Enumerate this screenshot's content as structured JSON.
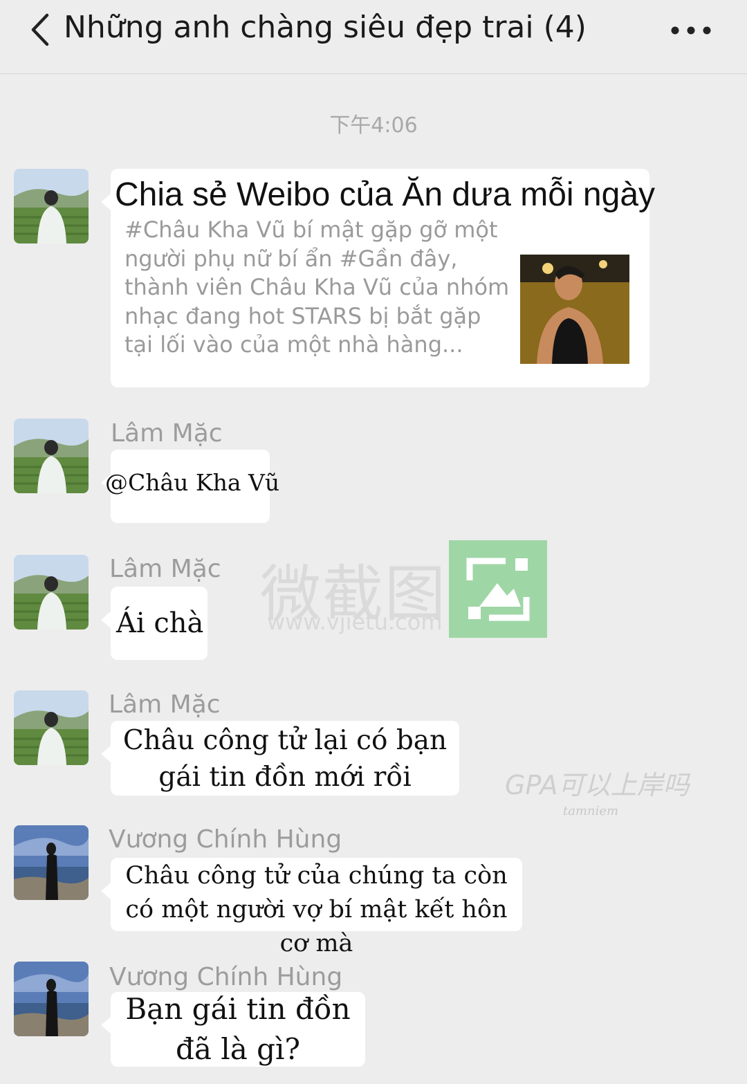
{
  "header": {
    "title": "Những anh chàng siêu đẹp trai (4)"
  },
  "timestamp": "下午4:06",
  "messages": [
    {
      "type": "link_card",
      "card_title": "Chia sẻ Weibo của Ăn dưa mỗi ngày",
      "card_description": "#Châu Kha Vũ bí mật gặp gỡ một người phụ nữ bí ẩn #Gần đây, thành viên Châu Kha Vũ của nhóm nhạc đang hot STARS bị bắt gặp tại lối vào của một nhà hàng..."
    },
    {
      "sender": "Lâm Mặc",
      "text": "@Châu Kha Vũ"
    },
    {
      "sender": "Lâm Mặc",
      "text": "Ái chà"
    },
    {
      "sender": "Lâm Mặc",
      "text": "Châu công tử lại có bạn gái tin đồn mới rồi"
    },
    {
      "sender": "Vương Chính Hùng",
      "text": "Châu công tử của chúng ta còn có một người vợ bí mật kết hôn cơ mà"
    },
    {
      "sender": "Vương Chính Hùng",
      "text": "Bạn gái tin đồn đã là gì?"
    }
  ],
  "watermarks": {
    "app_name": "微截图",
    "url": "www.vjietu.com",
    "gpa_text": "GPA可以上岸吗",
    "credit": "tamniem"
  },
  "icons": {
    "back": "chevron-left-icon",
    "more": "more-dots-icon"
  },
  "colors": {
    "background": "#ededed",
    "bubble": "#ffffff",
    "sender_name": "#9c9c9c",
    "timestamp": "#a8a8a8",
    "card_description": "#9a9a9a"
  }
}
